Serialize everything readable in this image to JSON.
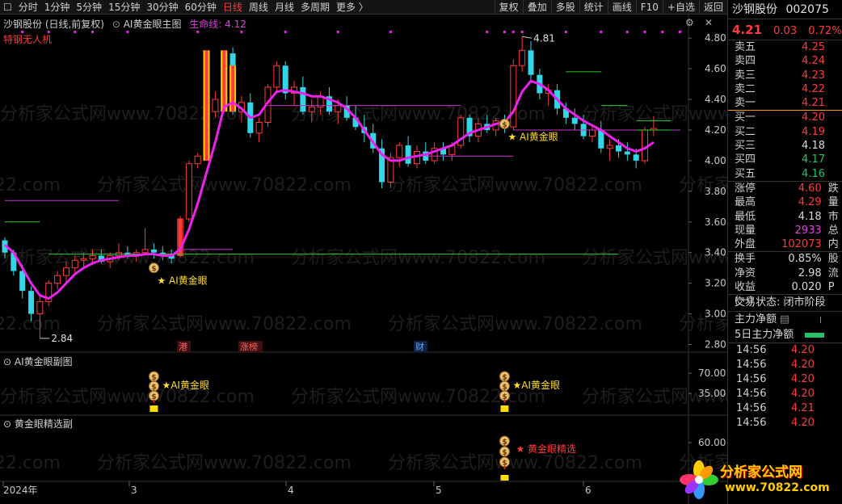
{
  "toolbar": {
    "items": [
      {
        "label": "分时",
        "active": false
      },
      {
        "label": "1分钟",
        "active": false
      },
      {
        "label": "5分钟",
        "active": false
      },
      {
        "label": "15分钟",
        "active": false
      },
      {
        "label": "30分钟",
        "active": false
      },
      {
        "label": "60分钟",
        "active": false
      },
      {
        "label": "日线",
        "active": true
      },
      {
        "label": "周线",
        "active": false
      },
      {
        "label": "月线",
        "active": false
      },
      {
        "label": "多周期",
        "active": false
      },
      {
        "label": "更多 〉",
        "active": false
      }
    ],
    "right_buttons": [
      "复权",
      "叠加",
      "多股",
      "统计",
      "画线",
      "F10",
      "+自选",
      "返回"
    ]
  },
  "main_panel": {
    "stock_label": "沙钢股份 (日线,前复权)",
    "indicator_name": "AI黄金眼主图",
    "lifeline_label": "生命线: 4.12",
    "tag": "特钢无人机",
    "high_mark": "4.81",
    "low_mark": "2.84",
    "signal1": "★ AI黄金眼",
    "signal2": "★ AI黄金眼",
    "y_ticks": [
      "4.80",
      "4.60",
      "4.40",
      "4.20",
      "4.00",
      "3.80",
      "3.60",
      "3.40",
      "3.20",
      "3.00",
      "2.80"
    ],
    "event_tags": [
      "港",
      "涨榜",
      "财"
    ]
  },
  "sub_panel1": {
    "title": "AI黄金眼副图",
    "signal1": "★AI黄金眼",
    "signal2": "★AI黄金眼",
    "y_ticks": [
      "70.00",
      "35.00"
    ]
  },
  "sub_panel2": {
    "title": "黄金眼精选副",
    "signal": "★ 黄金眼精选",
    "y_ticks": [
      "60.00"
    ]
  },
  "x_axis": [
    "2024年",
    "3",
    "4",
    "5",
    "6"
  ],
  "watermark": "分析家公式网www.70822.com",
  "right_panel": {
    "name": "沙钢股份",
    "code": "002075",
    "price": "4.21",
    "change": "0.03",
    "change_pct": "0.72%",
    "asks": [
      {
        "label": "卖五",
        "price": "4.25"
      },
      {
        "label": "卖四",
        "price": "4.24"
      },
      {
        "label": "卖三",
        "price": "4.23"
      },
      {
        "label": "卖二",
        "price": "4.22"
      },
      {
        "label": "卖一",
        "price": "4.21"
      }
    ],
    "bids": [
      {
        "label": "买一",
        "price": "4.20"
      },
      {
        "label": "买二",
        "price": "4.19"
      },
      {
        "label": "买三",
        "price": "4.18"
      },
      {
        "label": "买四",
        "price": "4.17"
      },
      {
        "label": "买五",
        "price": "4.16"
      }
    ],
    "stats": [
      {
        "label": "涨停",
        "value": "4.60",
        "side": "跌"
      },
      {
        "label": "最高",
        "value": "4.29",
        "side": "量"
      },
      {
        "label": "最低",
        "value": "4.18",
        "side": "市"
      },
      {
        "label": "现量",
        "value": "2933",
        "side": "总"
      },
      {
        "label": "外盘",
        "value": "102073",
        "side": "内"
      }
    ],
    "stats2": [
      {
        "label": "换手",
        "value": "0.85%",
        "side": "股"
      },
      {
        "label": "净资",
        "value": "2.98",
        "side": "流"
      },
      {
        "label": "收益(一)",
        "value": "0.020",
        "side": "P"
      }
    ],
    "trade_status": "交易状态: 闭市阶段",
    "main_net": "主力净额",
    "main_net_5d": "5日主力净额",
    "ticks": [
      {
        "time": "14:56",
        "price": "4.20"
      },
      {
        "time": "14:56",
        "price": "4.20"
      },
      {
        "time": "14:56",
        "price": "4.20"
      },
      {
        "time": "14:56",
        "price": "4.20"
      },
      {
        "time": "14:56",
        "price": "4.21"
      },
      {
        "time": "14:56",
        "price": "4.20"
      }
    ]
  },
  "logo": {
    "text": "分析家公式网",
    "url": "www.70822.com"
  },
  "chart_data": {
    "type": "candlestick",
    "ohlc": [
      [
        3.48,
        3.5,
        3.36,
        3.4
      ],
      [
        3.4,
        3.42,
        3.25,
        3.28
      ],
      [
        3.28,
        3.32,
        3.1,
        3.15
      ],
      [
        3.15,
        3.18,
        2.95,
        3.0
      ],
      [
        3.0,
        3.12,
        2.84,
        3.08
      ],
      [
        3.08,
        3.22,
        3.05,
        3.2
      ],
      [
        3.2,
        3.28,
        3.16,
        3.25
      ],
      [
        3.25,
        3.34,
        3.2,
        3.3
      ],
      [
        3.3,
        3.38,
        3.26,
        3.35
      ],
      [
        3.35,
        3.4,
        3.3,
        3.36
      ],
      [
        3.36,
        3.42,
        3.32,
        3.38
      ],
      [
        3.38,
        3.42,
        3.33,
        3.34
      ],
      [
        3.34,
        3.4,
        3.3,
        3.38
      ],
      [
        3.38,
        3.46,
        3.35,
        3.4
      ],
      [
        3.4,
        3.44,
        3.36,
        3.38
      ],
      [
        3.38,
        3.42,
        3.34,
        3.4
      ],
      [
        3.4,
        3.56,
        3.38,
        3.42
      ],
      [
        3.42,
        3.46,
        3.36,
        3.4
      ],
      [
        3.4,
        3.44,
        3.35,
        3.38
      ],
      [
        3.38,
        3.42,
        3.33,
        3.36
      ],
      [
        3.38,
        3.64,
        3.37,
        3.62
      ],
      [
        3.62,
        4.0,
        3.6,
        3.98
      ],
      [
        3.98,
        4.05,
        3.95,
        4.03
      ],
      [
        4.03,
        4.35,
        4.0,
        4.32
      ],
      [
        4.32,
        4.45,
        4.28,
        4.4
      ],
      [
        4.4,
        4.72,
        4.38,
        4.7
      ],
      [
        4.7,
        4.74,
        4.3,
        4.32
      ],
      [
        4.32,
        4.42,
        4.25,
        4.38
      ],
      [
        4.38,
        4.44,
        4.15,
        4.18
      ],
      [
        4.18,
        4.28,
        4.12,
        4.25
      ],
      [
        4.25,
        4.5,
        4.22,
        4.48
      ],
      [
        4.48,
        4.65,
        4.44,
        4.62
      ],
      [
        4.62,
        4.65,
        4.4,
        4.44
      ],
      [
        4.44,
        4.52,
        4.36,
        4.48
      ],
      [
        4.48,
        4.55,
        4.3,
        4.32
      ],
      [
        4.32,
        4.4,
        4.25,
        4.35
      ],
      [
        4.35,
        4.45,
        4.3,
        4.42
      ],
      [
        4.42,
        4.48,
        4.3,
        4.32
      ],
      [
        4.32,
        4.4,
        4.24,
        4.36
      ],
      [
        4.36,
        4.42,
        4.26,
        4.28
      ],
      [
        4.28,
        4.36,
        4.2,
        4.22
      ],
      [
        4.22,
        4.3,
        4.12,
        4.18
      ],
      [
        4.18,
        4.24,
        4.05,
        4.08
      ],
      [
        4.08,
        4.14,
        3.82,
        3.86
      ],
      [
        3.86,
        4.05,
        3.82,
        4.02
      ],
      [
        4.02,
        4.12,
        3.96,
        4.1
      ],
      [
        4.1,
        4.16,
        3.96,
        3.98
      ],
      [
        3.98,
        4.1,
        3.95,
        4.06
      ],
      [
        4.06,
        4.12,
        3.98,
        4.0
      ],
      [
        4.0,
        4.12,
        3.98,
        4.08
      ],
      [
        4.08,
        4.12,
        4.0,
        4.04
      ],
      [
        4.04,
        4.12,
        4.0,
        4.1
      ],
      [
        4.1,
        4.3,
        4.08,
        4.28
      ],
      [
        4.28,
        4.3,
        4.12,
        4.16
      ],
      [
        4.16,
        4.28,
        4.12,
        4.24
      ],
      [
        4.24,
        4.3,
        4.18,
        4.2
      ],
      [
        4.2,
        4.28,
        4.16,
        4.26
      ],
      [
        4.26,
        4.3,
        4.18,
        4.22
      ],
      [
        4.22,
        4.66,
        4.2,
        4.62
      ],
      [
        4.62,
        4.81,
        4.58,
        4.72
      ],
      [
        4.72,
        4.78,
        4.52,
        4.56
      ],
      [
        4.56,
        4.6,
        4.4,
        4.44
      ],
      [
        4.44,
        4.5,
        4.36,
        4.46
      ],
      [
        4.46,
        4.5,
        4.3,
        4.34
      ],
      [
        4.34,
        4.38,
        4.24,
        4.28
      ],
      [
        4.28,
        4.34,
        4.2,
        4.24
      ],
      [
        4.24,
        4.3,
        4.14,
        4.16
      ],
      [
        4.16,
        4.24,
        4.12,
        4.2
      ],
      [
        4.2,
        4.26,
        4.05,
        4.08
      ],
      [
        4.08,
        4.14,
        4.0,
        4.1
      ],
      [
        4.1,
        4.14,
        4.02,
        4.06
      ],
      [
        4.06,
        4.12,
        4.0,
        4.04
      ],
      [
        4.04,
        4.08,
        3.95,
        4.0
      ],
      [
        4.0,
        4.22,
        3.98,
        4.2
      ],
      [
        4.2,
        4.29,
        4.16,
        4.21
      ]
    ],
    "lifeline": [
      3.45,
      3.4,
      3.3,
      3.2,
      3.12,
      3.1,
      3.14,
      3.2,
      3.26,
      3.3,
      3.33,
      3.35,
      3.36,
      3.37,
      3.38,
      3.38,
      3.39,
      3.39,
      3.38,
      3.38,
      3.42,
      3.55,
      3.72,
      3.92,
      4.12,
      4.35,
      4.38,
      4.34,
      4.28,
      4.3,
      4.38,
      4.45,
      4.46,
      4.45,
      4.44,
      4.42,
      4.42,
      4.4,
      4.38,
      4.34,
      4.28,
      4.2,
      4.12,
      4.04,
      4.0,
      4.0,
      4.02,
      4.03,
      4.04,
      4.06,
      4.08,
      4.1,
      4.14,
      4.18,
      4.2,
      4.22,
      4.24,
      4.25,
      4.32,
      4.45,
      4.52,
      4.5,
      4.46,
      4.4,
      4.34,
      4.3,
      4.26,
      4.23,
      4.2,
      4.16,
      4.12,
      4.08,
      4.06,
      4.08,
      4.12
    ],
    "ylim": [
      2.75,
      4.88
    ],
    "signal_index": [
      17,
      57
    ]
  }
}
